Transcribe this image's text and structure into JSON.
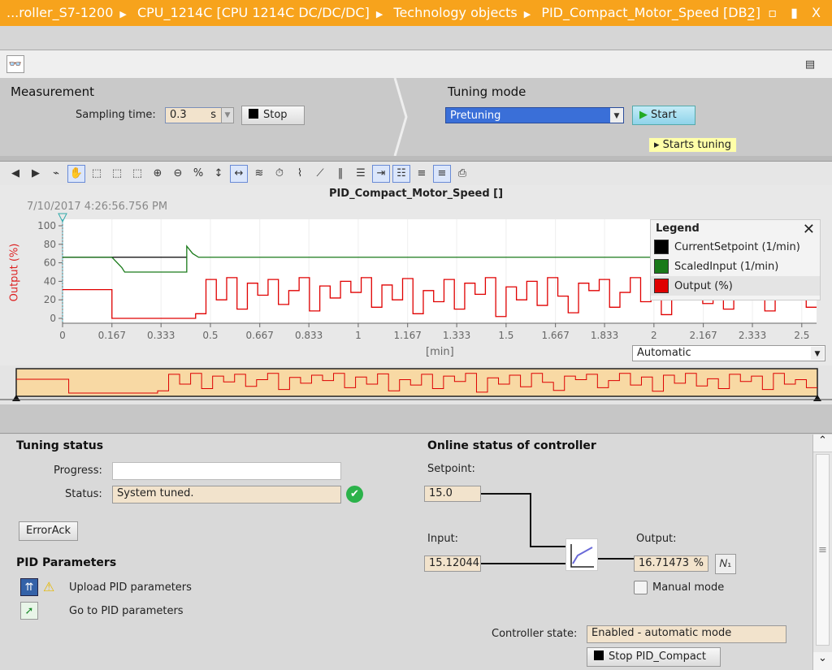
{
  "window": {
    "breadcrumb": [
      "...roller_S7-1200",
      "CPU_1214C [CPU 1214C DC/DC/DC]",
      "Technology objects",
      "PID_Compact_Motor_Speed [DB2]"
    ],
    "controls": "_ ▫ ▮ X"
  },
  "measurement": {
    "title": "Measurement",
    "sampling_label": "Sampling time:",
    "sampling_value": "0.3",
    "sampling_unit": "s",
    "stop_label": "Stop"
  },
  "tuning": {
    "title": "Tuning mode",
    "mode": "Pretuning",
    "start_label": "Start",
    "tooltip": "Starts tuning"
  },
  "chart": {
    "timestamp": "7/10/2017  4:26:56.756 PM",
    "range_mode": "Automatic",
    "legend_title": "Legend"
  },
  "chart_data": {
    "type": "line",
    "title": "PID_Compact_Motor_Speed []",
    "xlabel": "[min]",
    "ylabel": "Output (%)",
    "xlim": [
      0,
      2.55
    ],
    "ylim": [
      0,
      100
    ],
    "xticks": [
      "0",
      "0.167",
      "0.333",
      "0.5",
      "0.667",
      "0.833",
      "1",
      "1.167",
      "1.333",
      "1.5",
      "1.667",
      "1.833",
      "2",
      "2.167",
      "2.333",
      "2.5"
    ],
    "yticks": [
      "0",
      "20",
      "40",
      "60",
      "80",
      "100"
    ],
    "legend_position": "top-right",
    "series": [
      {
        "name": "CurrentSetpoint (1/min)",
        "color": "#000000",
        "x": [
          0,
          0.42
        ],
        "y": [
          66,
          66
        ]
      },
      {
        "name": "ScaledInput (1/min)",
        "color": "#1a7a1a",
        "x": [
          0,
          0.167,
          0.2,
          0.21,
          0.42,
          0.42,
          0.44,
          0.46,
          2.55
        ],
        "y": [
          66,
          66,
          55,
          50,
          50,
          78,
          70,
          66,
          66
        ]
      },
      {
        "name": "Output (%)",
        "color": "#e00000",
        "x": [
          0,
          0.167,
          0.167,
          0.44
        ],
        "y": [
          31,
          31,
          0,
          0
        ],
        "noise_start": 0.45,
        "noise_step": 0.035,
        "noise": [
          5,
          42,
          20,
          44,
          10,
          38,
          25,
          42,
          15,
          30,
          44,
          8,
          35,
          22,
          40,
          28,
          44,
          12,
          36,
          20,
          43,
          5,
          30,
          18,
          42,
          10,
          38,
          26,
          44,
          2,
          34,
          20,
          40,
          14,
          44,
          24,
          6,
          38,
          30,
          42,
          12,
          28,
          44,
          18,
          36,
          4,
          40,
          22,
          44,
          16,
          32,
          10,
          42,
          26,
          38,
          8,
          44,
          20,
          30,
          12
        ]
      }
    ]
  },
  "tuning_status": {
    "title": "Tuning status",
    "progress_label": "Progress:",
    "progress": 0,
    "status_label": "Status:",
    "status_value": "System tuned.",
    "errorack": "ErrorAck"
  },
  "pid": {
    "title": "PID Parameters",
    "upload": "Upload PID parameters",
    "goto": "Go to PID parameters"
  },
  "online": {
    "title": "Online status of controller",
    "setpoint_label": "Setpoint:",
    "setpoint": "15.0",
    "input_label": "Input:",
    "input": "15.12044",
    "output_label": "Output:",
    "output": "16.71473",
    "output_unit": "%",
    "manual": "Manual mode",
    "state_label": "Controller state:",
    "state": "Enabled - automatic mode",
    "stop_pid": "Stop PID_Compact"
  }
}
